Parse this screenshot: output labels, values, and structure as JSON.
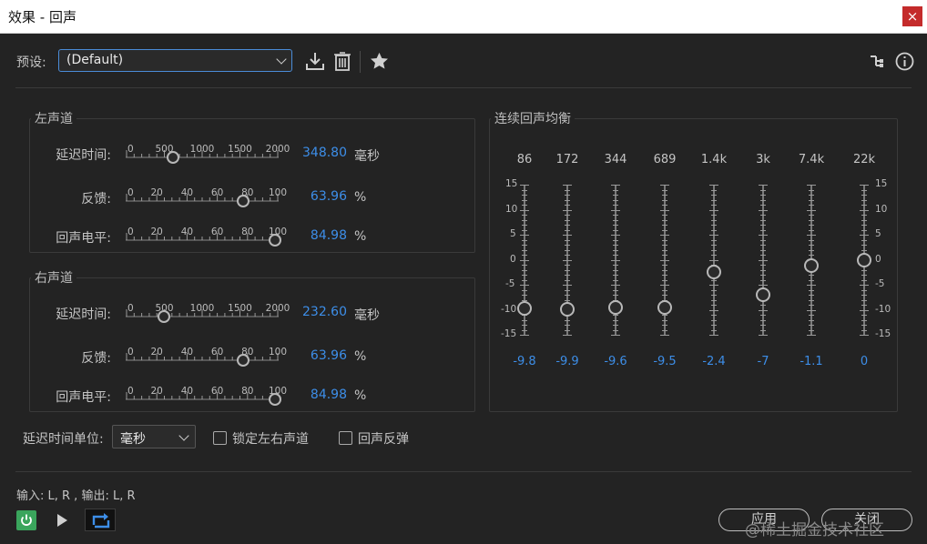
{
  "window": {
    "title": "效果 - 回声",
    "close_symbol": "×"
  },
  "preset": {
    "label": "预设:",
    "value": "(Default)"
  },
  "left_channel": {
    "title": "左声道",
    "delay": {
      "label": "延迟时间:",
      "ticks": [
        "0",
        "500",
        "1000",
        "1500",
        "2000"
      ],
      "value": "348.80",
      "unit": "毫秒",
      "fraction": 0.1744
    },
    "feedback": {
      "label": "反馈:",
      "ticks": [
        "0",
        "20",
        "40",
        "60",
        "80",
        "100"
      ],
      "value": "63.96",
      "unit": "%",
      "fraction": 0.6396
    },
    "echo_level": {
      "label": "回声电平:",
      "ticks": [
        "0",
        "20",
        "40",
        "60",
        "80",
        "100"
      ],
      "value": "84.98",
      "unit": "%",
      "fraction": 0.8498
    }
  },
  "right_channel": {
    "title": "右声道",
    "delay": {
      "label": "延迟时间:",
      "ticks": [
        "0",
        "500",
        "1000",
        "1500",
        "2000"
      ],
      "value": "232.60",
      "unit": "毫秒",
      "fraction": 0.1163
    },
    "feedback": {
      "label": "反馈:",
      "ticks": [
        "0",
        "20",
        "40",
        "60",
        "80",
        "100"
      ],
      "value": "63.96",
      "unit": "%",
      "fraction": 0.6396
    },
    "echo_level": {
      "label": "回声电平:",
      "ticks": [
        "0",
        "20",
        "40",
        "60",
        "80",
        "100"
      ],
      "value": "84.98",
      "unit": "%",
      "fraction": 0.8498
    }
  },
  "eq": {
    "title": "连续回声均衡",
    "bands": [
      "86",
      "172",
      "344",
      "689",
      "1.4k",
      "3k",
      "7.4k",
      "22k"
    ],
    "values": [
      -9.8,
      -9.9,
      -9.6,
      -9.5,
      -2.4,
      -7,
      -1.1,
      0
    ],
    "value_labels": [
      "-9.8",
      "-9.9",
      "-9.6",
      "-9.5",
      "-2.4",
      "-7",
      "-1.1",
      "0"
    ],
    "scale": [
      "15",
      "10",
      "5",
      "0",
      "-5",
      "-10",
      "-15"
    ],
    "range": [
      -15,
      15
    ]
  },
  "options": {
    "delay_unit_label": "延迟时间单位:",
    "delay_unit_value": "毫秒",
    "lock_channels_label": "锁定左右声道",
    "lock_channels_checked": false,
    "echo_bounce_label": "回声反弹",
    "echo_bounce_checked": false
  },
  "io": {
    "text": "输入: L, R , 输出: L, R"
  },
  "buttons": {
    "apply": "应用",
    "close": "关闭"
  },
  "watermark": "@稀土掘金技术社区",
  "colors": {
    "accent": "#3d8ee8",
    "power": "#3aa55c",
    "close": "#c42b2b"
  }
}
